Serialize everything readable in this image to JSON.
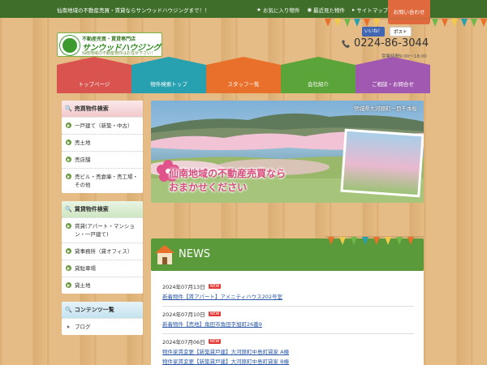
{
  "topbar": {
    "tagline": "仙南地域の不動産売買・賃貸ならサンウッドハウジングまで！！",
    "links": [
      {
        "label": "お気に入り物件",
        "icon": "star-icon"
      },
      {
        "label": "最近見た物件",
        "icon": "eye-icon"
      },
      {
        "label": "サイトマップ",
        "icon": "sitemap-icon"
      }
    ],
    "contact": "お問い合わせ"
  },
  "logo": {
    "line1": "不動産売買・賃貸専門店",
    "line2": "サンウッドハウジング",
    "line3": "仙南地域の不動産物件はお任せ下さい！"
  },
  "social": {
    "fb": "いいね！",
    "x": "ポスト"
  },
  "phone": {
    "number": "0224-86-3044",
    "hours": "営業時間9:00～18:00"
  },
  "nav": [
    {
      "label": "トップページ",
      "color": "#d9534f"
    },
    {
      "label": "物件検索トップ",
      "color": "#27a0b0"
    },
    {
      "label": "スタッフ一覧",
      "color": "#e8702a"
    },
    {
      "label": "会社紹介",
      "color": "#5aa43a"
    },
    {
      "label": "ご相談・お問合せ",
      "color": "#a158b0"
    }
  ],
  "sidebar": {
    "sale": {
      "title": "売買物件検索",
      "items": [
        "一戸建て（新築・中古）",
        "売土地",
        "売店舗",
        "売ビル・売倉庫・売工場・その他"
      ]
    },
    "rent": {
      "title": "賃貸物件検索",
      "items": [
        "賃貸(アパート・マンション・一戸建て)",
        "貸事務所（貸オフィス）",
        "貸駐車場",
        "貸土地"
      ]
    },
    "content": {
      "title": "コンテンツ一覧",
      "items": [
        "ブログ"
      ]
    }
  },
  "hero": {
    "caption": "宮城県大河原町一目千本桜",
    "message_line1": "仙南地域の不動産売買なら",
    "message_line2": "おまかせください"
  },
  "news": {
    "title": "NEWS",
    "new_label": "NEW",
    "items": [
      {
        "date": "2024年07月13日",
        "links": [
          "新着物件【賃アパート】アメニティハウス202号室"
        ]
      },
      {
        "date": "2024年07月10日",
        "links": [
          "新着物件【売地】角田市角田字旭町26番9"
        ]
      },
      {
        "date": "2024年07月06日",
        "links": [
          "物件家賃変更【新築貸戸建】大河原町中島町貸家 A棟",
          "物件家賃変更【新築貸戸建】大河原町中島町貸家 B棟"
        ]
      }
    ]
  }
}
